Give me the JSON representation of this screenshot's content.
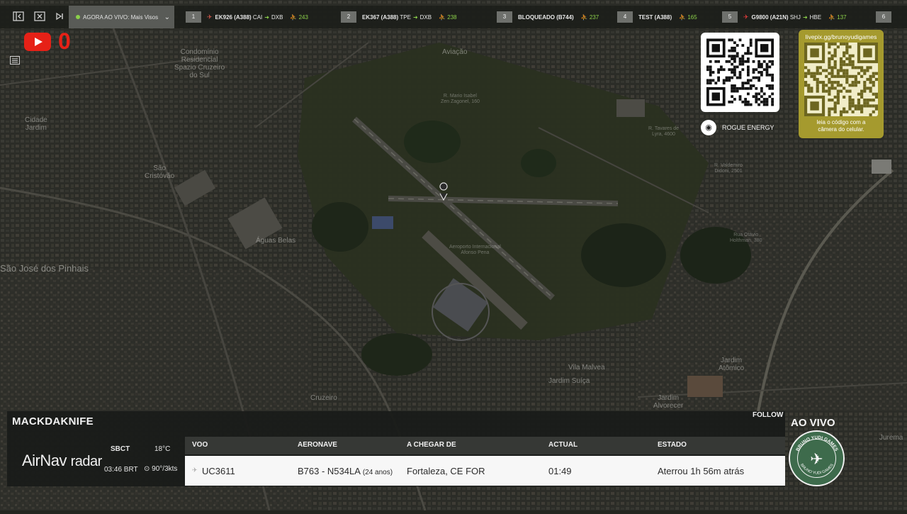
{
  "topbar": {
    "now_live": "AGORA AO VIVO: Mais Visos",
    "flights": [
      {
        "num": "1",
        "code": "EK926 (A388)",
        "dep": "CAI",
        "arr": "DXB",
        "pax": "243",
        "plane_color": "#d2574a"
      },
      {
        "num": "2",
        "code": "EK367 (A388)",
        "dep": "TPE",
        "arr": "DXB",
        "pax": "238",
        "plane_color": "#d2574a"
      },
      {
        "num": "3",
        "code": "BLOQUEADO (B744)",
        "dep": "",
        "arr": "",
        "pax": "237",
        "plane_color": ""
      },
      {
        "num": "4",
        "code": "TEST (A388)",
        "dep": "",
        "arr": "",
        "pax": "165",
        "plane_color": ""
      },
      {
        "num": "5",
        "code": "G9800 (A21N)",
        "dep": "SHJ",
        "arr": "HBE",
        "pax": "137",
        "plane_color": "#e23b3b"
      },
      {
        "num": "6",
        "code": "",
        "dep": "",
        "arr": "",
        "pax": "",
        "plane_color": ""
      }
    ]
  },
  "youtube": {
    "count": "0"
  },
  "map_labels": {
    "condominio": "Condomínio\nResidencial\nSpazio Cruzeiro\ndo Sul",
    "aviacao": "Aviação",
    "rua_mario": "R. Mario Isabel\nZen Zagonel, 160",
    "cidade_jardim": "Cidade\nJardim",
    "sao_cristovao": "São\nCristóvão",
    "aguas_belas": "Águas Belas",
    "sao_jose": "São José dos Pinhais",
    "aeroporto": "Aeroporto Internacional\nAfonso Pena",
    "vila_malvea": "Vila Malvea",
    "jardim_suica": "Jardim Suíça",
    "jardim_atomico": "Jardim\nAtômico",
    "jardim_alvorecer": "Jardim\nAlvorecer",
    "cruzeiro": "Cruzeiro",
    "jurema": "Jurema",
    "rua_tavares": "R. Tavares de\nLyra, 4600",
    "rua_valdemiro": "R. Valdemiro\nDidoni, 2501",
    "rua_holthman": "Rua Otávio\nHolthman, 380"
  },
  "qr": {
    "sponsor": "ROGUE ENERGY",
    "url": "livepix.gg/brunoyudigames",
    "caption": "leia o código com a\ncâmera do celular."
  },
  "panel": {
    "callsign": "MACKDAKNIFE",
    "follow": "FOLLOW",
    "brand_main": "AirNav",
    "brand_sub": "radar",
    "airport": "SBCT",
    "time": "03:46 BRT",
    "temp": "18°C",
    "wind": "90°/3kts",
    "headers": {
      "flight": "VOO",
      "aircraft": "AERONAVE",
      "from": "A CHEGAR DE",
      "actual": "ACTUAL",
      "status": "ESTADO"
    },
    "row": {
      "flight": "UC3611",
      "aircraft": "B763 - N534LA",
      "aircraft_age": "(24 anos)",
      "from": "Fortaleza, CE FOR",
      "actual": "01:49",
      "status": "Aterrou 1h 56m atrás"
    }
  },
  "live": {
    "label": "AO VIVO",
    "badge_top": "BRUNO YUDI GAMES",
    "badge_bottom": "BRUNO YUDI GAMES"
  },
  "colors": {
    "accent_green": "#8bd04a",
    "youtube_red": "#e62117",
    "qr_gold": "#a59a2e"
  }
}
